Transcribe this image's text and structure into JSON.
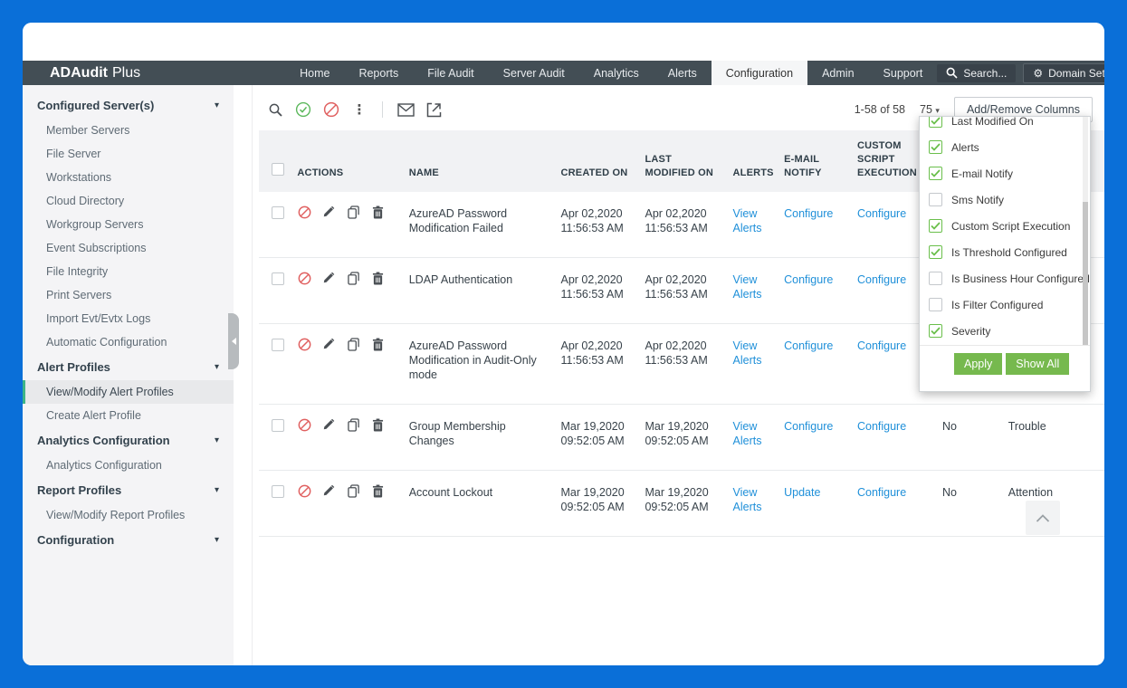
{
  "nav": {
    "brand_bold": "ADAudit",
    "brand_light": "Plus",
    "tabs": [
      {
        "label": "Home",
        "active": false
      },
      {
        "label": "Reports",
        "active": false
      },
      {
        "label": "File Audit",
        "active": false
      },
      {
        "label": "Server Audit",
        "active": false
      },
      {
        "label": "Analytics",
        "active": false
      },
      {
        "label": "Alerts",
        "active": false
      },
      {
        "label": "Configuration",
        "active": true
      },
      {
        "label": "Admin",
        "active": false
      },
      {
        "label": "Support",
        "active": false
      }
    ],
    "search_label": "Search...",
    "domain_settings_label": "Domain Settings"
  },
  "sidebar": {
    "items": [
      {
        "label": "Configured Server(s)",
        "kind": "header"
      },
      {
        "label": "Member Servers",
        "kind": "item",
        "selected": false
      },
      {
        "label": "File Server",
        "kind": "item",
        "selected": false
      },
      {
        "label": "Workstations",
        "kind": "item",
        "selected": false
      },
      {
        "label": "Cloud Directory",
        "kind": "item",
        "selected": false
      },
      {
        "label": "Workgroup Servers",
        "kind": "item",
        "selected": false
      },
      {
        "label": "Event Subscriptions",
        "kind": "item",
        "selected": false
      },
      {
        "label": "File Integrity",
        "kind": "item",
        "selected": false
      },
      {
        "label": "Print Servers",
        "kind": "item",
        "selected": false
      },
      {
        "label": "Import Evt/Evtx Logs",
        "kind": "item",
        "selected": false
      },
      {
        "label": "Automatic Configuration",
        "kind": "item",
        "selected": false
      },
      {
        "label": "Alert Profiles",
        "kind": "header"
      },
      {
        "label": "View/Modify Alert Profiles",
        "kind": "item",
        "selected": true
      },
      {
        "label": "Create Alert Profile",
        "kind": "item",
        "selected": false
      },
      {
        "label": "Analytics Configuration",
        "kind": "header"
      },
      {
        "label": "Analytics Configuration",
        "kind": "item",
        "selected": false
      },
      {
        "label": "Report Profiles",
        "kind": "header"
      },
      {
        "label": "View/Modify Report Profiles",
        "kind": "item",
        "selected": false
      },
      {
        "label": "Configuration",
        "kind": "header"
      }
    ]
  },
  "toolbar": {
    "pagination": "1-58 of 58",
    "page_size": "75",
    "add_remove_columns_label": "Add/Remove Columns"
  },
  "table": {
    "columns": [
      "ACTIONS",
      "NAME",
      "CREATED ON",
      "LAST MODIFIED ON",
      "ALERTS",
      "E-MAIL NOTIFY",
      "CUSTOM SCRIPT EXECUTION"
    ],
    "rows": [
      {
        "name": "AzureAD Password Modification Failed",
        "created_on": "Apr 02,2020 11:56:53 AM",
        "last_modified_on": "Apr 02,2020 11:56:53 AM",
        "alerts": "View Alerts",
        "email_notify": "Configure",
        "custom_script": "Configure",
        "is_threshold": "",
        "severity": ""
      },
      {
        "name": "LDAP Authentication",
        "created_on": "Apr 02,2020 11:56:53 AM",
        "last_modified_on": "Apr 02,2020 11:56:53 AM",
        "alerts": "View Alerts",
        "email_notify": "Configure",
        "custom_script": "Configure",
        "is_threshold": "",
        "severity": ""
      },
      {
        "name": "AzureAD Password Modification in Audit-Only mode",
        "created_on": "Apr 02,2020 11:56:53 AM",
        "last_modified_on": "Apr 02,2020 11:56:53 AM",
        "alerts": "View Alerts",
        "email_notify": "Configure",
        "custom_script": "Configure",
        "is_threshold": "",
        "severity": ""
      },
      {
        "name": "Group Membership Changes",
        "created_on": "Mar 19,2020 09:52:05 AM",
        "last_modified_on": "Mar 19,2020 09:52:05 AM",
        "alerts": "View Alerts",
        "email_notify": "Configure",
        "custom_script": "Configure",
        "is_threshold": "No",
        "severity": "Trouble"
      },
      {
        "name": "Account Lockout",
        "created_on": "Mar 19,2020 09:52:05 AM",
        "last_modified_on": "Mar 19,2020 09:52:05 AM",
        "alerts": "View Alerts",
        "email_notify": "Update",
        "custom_script": "Configure",
        "is_threshold": "No",
        "severity": "Attention"
      }
    ]
  },
  "columns_dropdown": {
    "items": [
      {
        "label": "Last Modified On",
        "checked": true
      },
      {
        "label": "Alerts",
        "checked": true
      },
      {
        "label": "E-mail Notify",
        "checked": true
      },
      {
        "label": "Sms Notify",
        "checked": false
      },
      {
        "label": "Custom Script Execution",
        "checked": true
      },
      {
        "label": "Is Threshold Configured",
        "checked": true
      },
      {
        "label": "Is Business Hour Configured",
        "checked": false
      },
      {
        "label": "Is Filter Configured",
        "checked": false
      },
      {
        "label": "Severity",
        "checked": true
      }
    ],
    "apply_label": "Apply",
    "show_all_label": "Show All"
  },
  "colors": {
    "frame_blue": "#0a6fd8",
    "navbar": "#434e55",
    "link": "#2090d9",
    "green_button": "#76b94e",
    "checkbox_green": "#6abf4b",
    "selected_accent": "#3cb488",
    "danger_red": "#d9534f",
    "success_green": "#5cb85c"
  }
}
